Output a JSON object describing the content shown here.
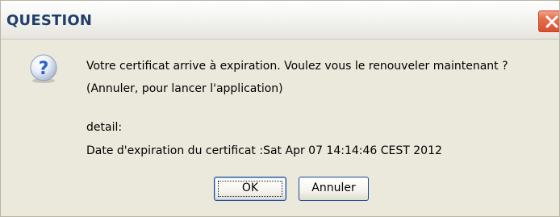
{
  "window": {
    "title": "QUESTION"
  },
  "icons": {
    "close": "close-icon",
    "question": "question-icon"
  },
  "message": {
    "line1": "Votre certificat arrive à expiration. Voulez vous le renouveler maintenant ?",
    "line2": "(Annuler, pour lancer l'application)",
    "detail_label": "detail:",
    "detail_text": "Date d'expiration du certificat :Sat Apr 07 14:14:46 CEST 2012"
  },
  "buttons": {
    "ok": "OK",
    "cancel": "Annuler"
  },
  "colors": {
    "title_text": "#1f3e6b",
    "dialog_background": "#ebe9db",
    "close_button": "#d7502c",
    "question_icon": "#2b63c7"
  }
}
